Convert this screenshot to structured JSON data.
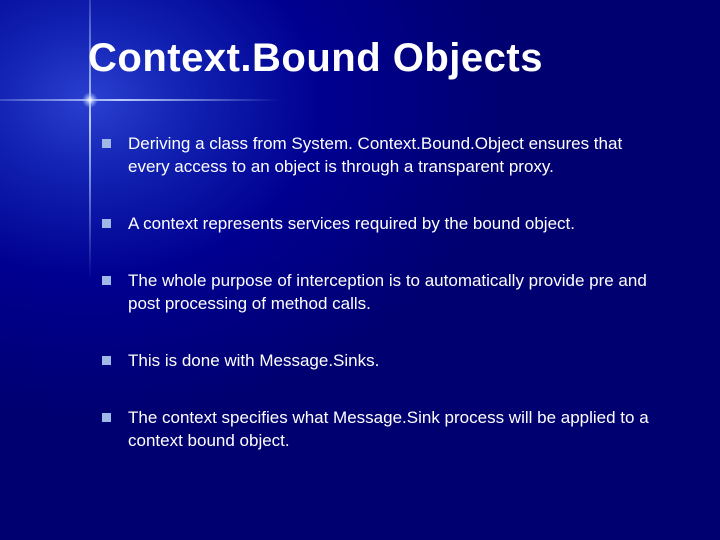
{
  "slide": {
    "title": "Context.Bound Objects",
    "bullets": [
      "Deriving a class from System. Context.Bound.Object ensures that every access to an object is through a transparent proxy.",
      "A context represents services required by the bound object.",
      "The whole purpose of interception is to automatically provide pre and post processing of method calls.",
      "This is done with Message.Sinks.",
      "The context specifies what Message.Sink process will be applied to a context bound object."
    ]
  }
}
